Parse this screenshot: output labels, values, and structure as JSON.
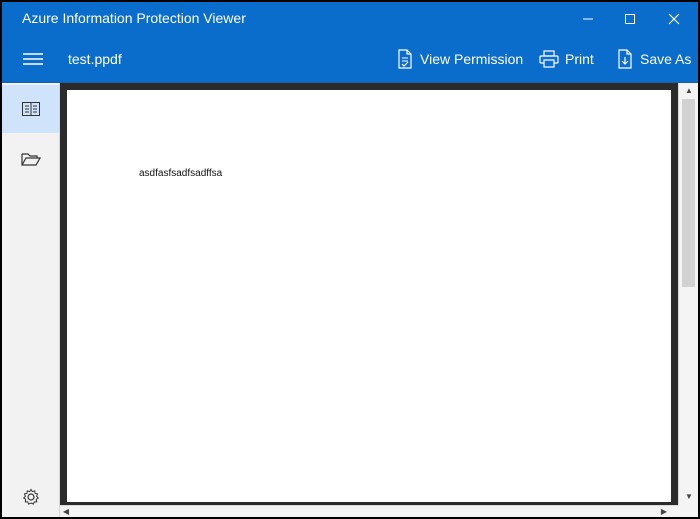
{
  "window": {
    "title": "Azure Information Protection Viewer"
  },
  "toolbar": {
    "file_name": "test.ppdf",
    "view_permission_label": "View Permission",
    "print_label": "Print",
    "save_as_label": "Save As"
  },
  "sidebar": {
    "items": [
      {
        "icon": "reader-icon",
        "active": true
      },
      {
        "icon": "folder-open-icon",
        "active": false
      }
    ],
    "footer_icon": "gear-icon"
  },
  "document": {
    "text": "asdfasfsadfsadffsa"
  },
  "colors": {
    "accent": "#0a6ccb",
    "selection": "#cfe3fa",
    "viewer_bg": "#2b2b2b"
  }
}
